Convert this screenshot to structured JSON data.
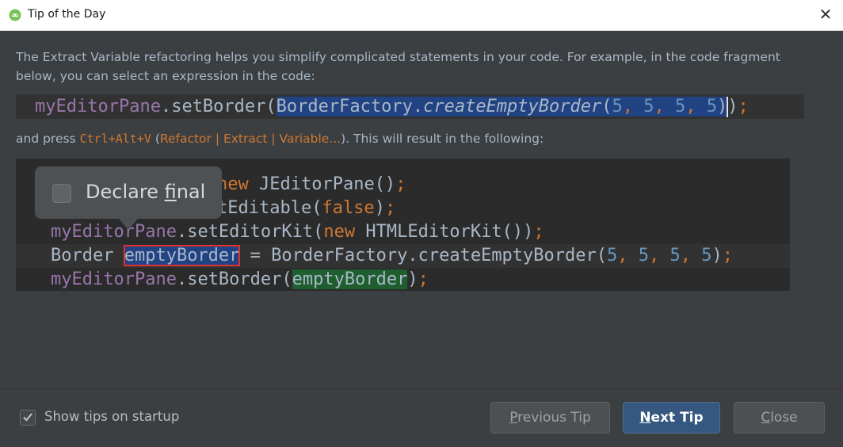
{
  "window": {
    "title": "Tip of the Day",
    "app_icon": "android-studio-icon",
    "close_glyph": "✕"
  },
  "tip": {
    "description": "The Extract Variable refactoring helps you simplify complicated statements in your code. For example, in the code fragment below, you can select an expression in the code:",
    "code_before": {
      "receiver": "myEditorPane",
      "method": ".setBorder(",
      "sel_class": "BorderFactory.",
      "sel_method": "createEmptyBorder",
      "sel_open": "(",
      "n1": "5",
      "n2": "5",
      "n3": "5",
      "n4": "5",
      "sel_close": ")",
      "tail": ")",
      "semicolon": ";",
      "comma": ", "
    },
    "press": {
      "prefix": "and press ",
      "shortcut": "Ctrl+Alt+V",
      "open_paren": " (",
      "menu_path": "Refactor | Extract | Variable...",
      "suffix": "). This will result in the following:"
    },
    "code_after": {
      "line1_kw": "new",
      "line1_rest": " JEditorPane()",
      "line2_rest": "tEditable(",
      "line2_kw": "false",
      "line3_var": "myEditorPane",
      "line3_method": ".setEditorKit(",
      "line3_kw": "new",
      "line3_rest": " HTMLEditorKit())",
      "line4_type": "Border ",
      "line4_var": "emptyBorder",
      "line4_mid": " = BorderFactory.createEmptyBorder(",
      "line5_var": "myEditorPane",
      "line5_method": ".setBorder(",
      "line5_arg": "emptyBorder",
      "close_paren": ")",
      "semicolon": ";",
      "comma": ", ",
      "n": "5"
    },
    "popup": {
      "label_pre": "Declare ",
      "label_mnemonic": "f",
      "label_post": "inal",
      "checked": false
    }
  },
  "footer": {
    "show_tips_label": "Show tips on startup",
    "show_tips_checked": true,
    "previous_mnemonic": "P",
    "previous_rest": "revious Tip",
    "next_mnemonic": "N",
    "next_rest": "ext Tip",
    "close_mnemonic": "C",
    "close_rest": "lose"
  },
  "colors": {
    "background": "#3c3f41",
    "editor_bg": "#2b2b2b",
    "keyword": "#cc7832",
    "field": "#9876aa",
    "number": "#6897bb",
    "selection": "#214283",
    "primary_button": "#365880"
  }
}
